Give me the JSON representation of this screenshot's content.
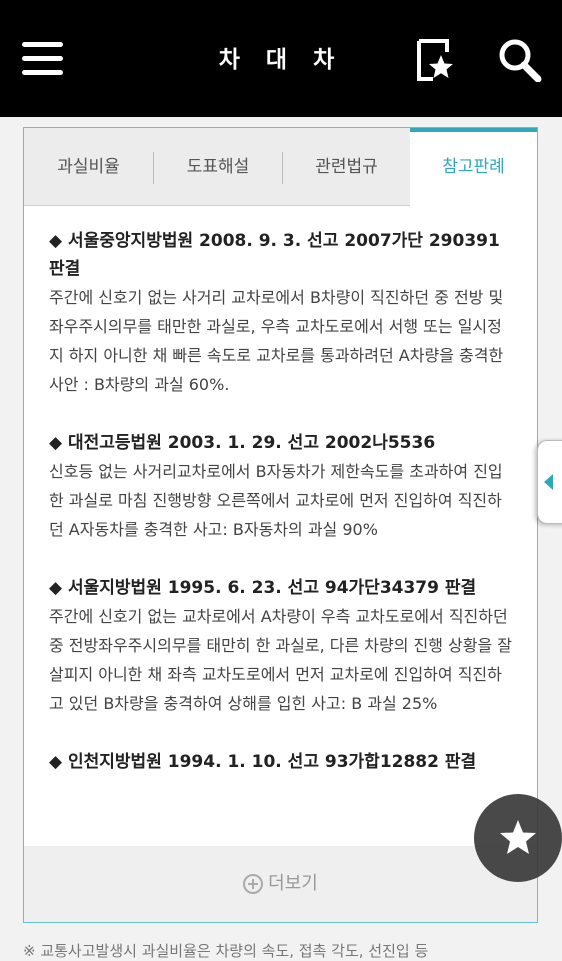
{
  "header": {
    "title": "차 대 차",
    "menu_icon": "hamburger-menu-icon",
    "bookmark_icon": "bookmark-star-icon",
    "search_icon": "search-icon"
  },
  "tabs": [
    {
      "label": "과실비율",
      "active": false
    },
    {
      "label": "도표해설",
      "active": false
    },
    {
      "label": "관련법규",
      "active": false
    },
    {
      "label": "참고판례",
      "active": true
    }
  ],
  "cases": [
    {
      "title": "◆ 서울중앙지방법원 2008. 9. 3. 선고 2007가단 290391 판결",
      "body": "주간에 신호기 없는 사거리 교차로에서 B차량이 직진하던 중 전방 및 좌우주시의무를 태만한 과실로, 우측 교차도로에서 서행 또는 일시정지 하지 아니한 채 빠른 속도로 교차로를 통과하려던 A차량을 충격한 사안 : B차량의 과실 60%."
    },
    {
      "title": "◆ 대전고등법원 2003. 1. 29. 선고 2002나5536",
      "body": "신호등 없는 사거리교차로에서 B자동차가 제한속도를 초과하여 진입한 과실로 마침 진행방향 오른쪽에서 교차로에 먼저 진입하여 직진하던 A자동차를 충격한 사고: B자동차의 과실 90%"
    },
    {
      "title": "◆ 서울지방법원 1995. 6. 23. 선고 94가단34379 판결",
      "body": "주간에 신호기 없는 교차로에서 A차량이 우측 교차도로에서 직진하던 중 전방좌우주시의무를 태만히 한 과실로, 다른 차량의 진행 상황을 잘 살피지 아니한 채 좌측 교차도로에서 먼저 교차로에 진입하여 직진하고 있던 B차량을 충격하여 상해를 입힌 사고: B 과실 25%"
    },
    {
      "title": "◆ 인천지방법원 1994. 1. 10. 선고 93가합12882 판결",
      "body": ""
    }
  ],
  "more_button": {
    "label": "더보기",
    "icon": "plus-circle-icon"
  },
  "floating_button_icon": "star-icon",
  "side_handle_icon": "triangle-left-icon",
  "footnote": "※ 교통사고발생시 과실비율은 차량의 속도, 접촉 각도, 선진입 등",
  "colors": {
    "accent": "#2fa8bc",
    "header_bg": "#000000",
    "fab": "#3a3a3a"
  }
}
